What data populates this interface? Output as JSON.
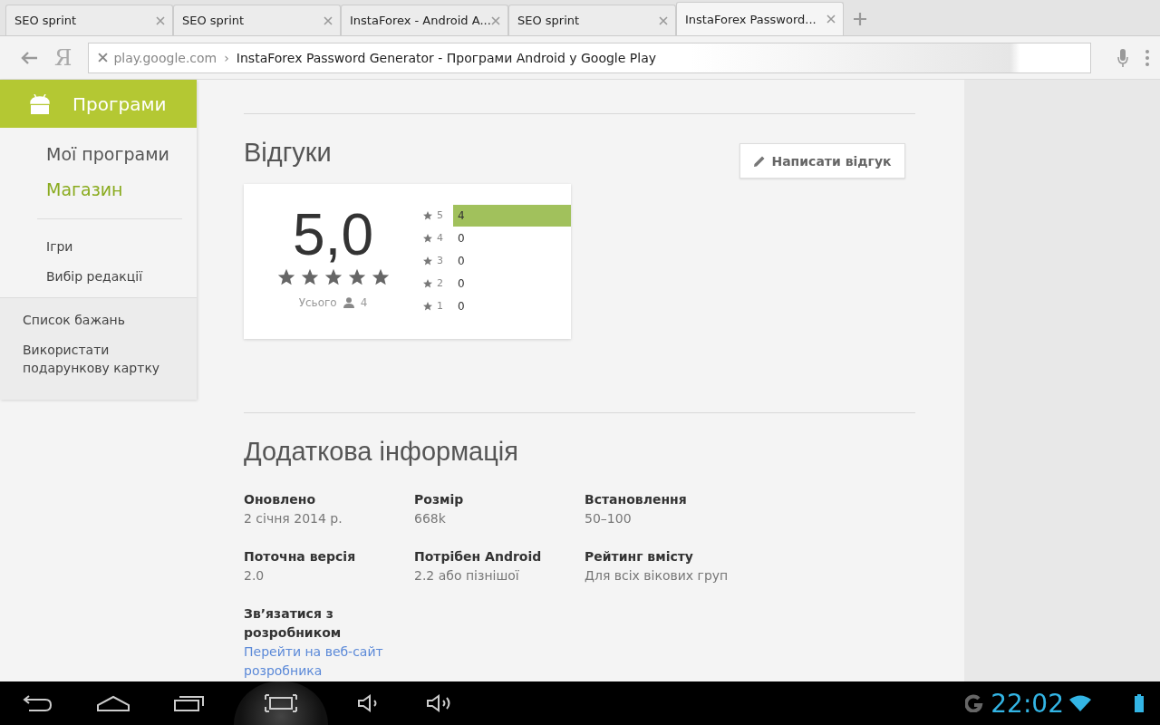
{
  "tabs": [
    {
      "label": "SEO sprint",
      "selected": false
    },
    {
      "label": "SEO sprint",
      "selected": false
    },
    {
      "label": "InstaForex - Android A...",
      "selected": false
    },
    {
      "label": "SEO sprint",
      "selected": false
    },
    {
      "label": "InstaForex Password...",
      "selected": true
    }
  ],
  "address_bar": {
    "domain": "play.google.com",
    "separator": "›",
    "title": "InstaForex Password Generator - Програми Android у Google Play"
  },
  "search_engine_letter": "Я",
  "sidebar": {
    "header": "Програми",
    "primary": [
      {
        "label": "Мої програми",
        "selected": false
      },
      {
        "label": "Магазин",
        "selected": true
      }
    ],
    "secondary": [
      {
        "label": "Ігри"
      },
      {
        "label": "Вибір редакції"
      }
    ],
    "footer": [
      {
        "label": "Список бажань"
      },
      {
        "label": "Використати подарункову картку"
      }
    ]
  },
  "reviews": {
    "title": "Відгуки",
    "write_button": "Написати відгук",
    "score": "5,0",
    "stars": 5,
    "total_label": "Усього",
    "total_count": "4",
    "histogram": [
      {
        "star": "5",
        "count": "4",
        "level": 1
      },
      {
        "star": "4",
        "count": "0"
      },
      {
        "star": "3",
        "count": "0"
      },
      {
        "star": "2",
        "count": "0"
      },
      {
        "star": "1",
        "count": "0"
      }
    ]
  },
  "additional_info": {
    "title": "Додаткова інформація",
    "items": [
      {
        "label": "Оновлено",
        "value": "2 січня 2014 р.",
        "kind": "text"
      },
      {
        "label": "Розмір",
        "value": "668k",
        "kind": "text"
      },
      {
        "label": "Встановлення",
        "value": "50–100",
        "kind": "text"
      },
      {
        "label": "Поточна версія",
        "value": "2.0",
        "kind": "text"
      },
      {
        "label": "Потрібен Android",
        "value": "2.2 або пізнішої",
        "kind": "text"
      },
      {
        "label": "Рейтинг вмісту",
        "value": "Для всіх вікових груп",
        "kind": "text"
      },
      {
        "label": "Зв’язатися з розробником",
        "value": "Перейти на веб-сайт розробника",
        "kind": "link"
      }
    ]
  },
  "status_bar": {
    "time": "22:02"
  }
}
